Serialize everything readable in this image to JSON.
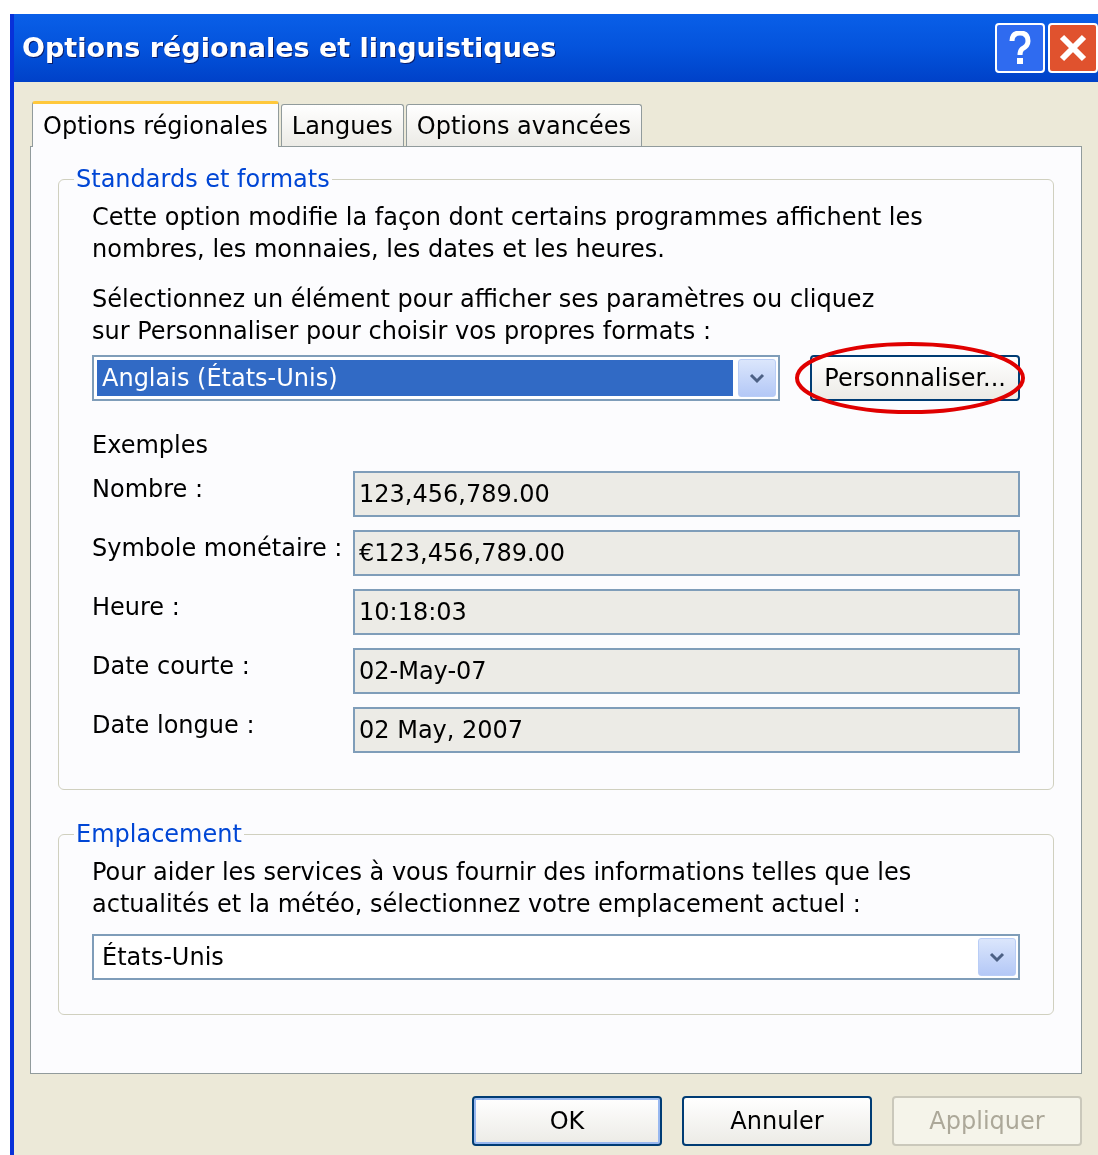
{
  "window": {
    "title": "Options régionales et linguistiques"
  },
  "tabs": [
    {
      "label": "Options régionales",
      "selected": true
    },
    {
      "label": "Langues",
      "selected": false
    },
    {
      "label": "Options avancées",
      "selected": false
    }
  ],
  "standards": {
    "legend": "Standards et formats",
    "description": "Cette option modifie la façon dont certains programmes affichent les nombres, les monnaies, les dates et les heures.",
    "instruction": "Sélectionnez un élément pour afficher ses paramètres ou cliquez sur Personnaliser pour choisir vos propres formats :",
    "dropdown": {
      "value": "Anglais (États-Unis)",
      "highlighted": true
    },
    "customize_button": {
      "label": "Personnaliser...",
      "circled": true
    },
    "examples_heading": "Exemples",
    "examples": [
      {
        "label": "Nombre :",
        "value": "123,456,789.00"
      },
      {
        "label": "Symbole monétaire :",
        "value": "€123,456,789.00"
      },
      {
        "label": "Heure :",
        "value": "10:18:03"
      },
      {
        "label": "Date courte :",
        "value": "02-May-07"
      },
      {
        "label": "Date longue :",
        "value": "02 May, 2007"
      }
    ]
  },
  "location": {
    "legend": "Emplacement",
    "description": "Pour aider les services à vous fournir des informations telles que les actualités et la météo, sélectionnez votre emplacement actuel :",
    "dropdown": {
      "value": "États-Unis",
      "highlighted": false
    }
  },
  "buttons": [
    {
      "label": "OK",
      "disabled": false,
      "default": true
    },
    {
      "label": "Annuler",
      "disabled": false,
      "default": false
    },
    {
      "label": "Appliquer",
      "disabled": true,
      "default": false
    }
  ]
}
